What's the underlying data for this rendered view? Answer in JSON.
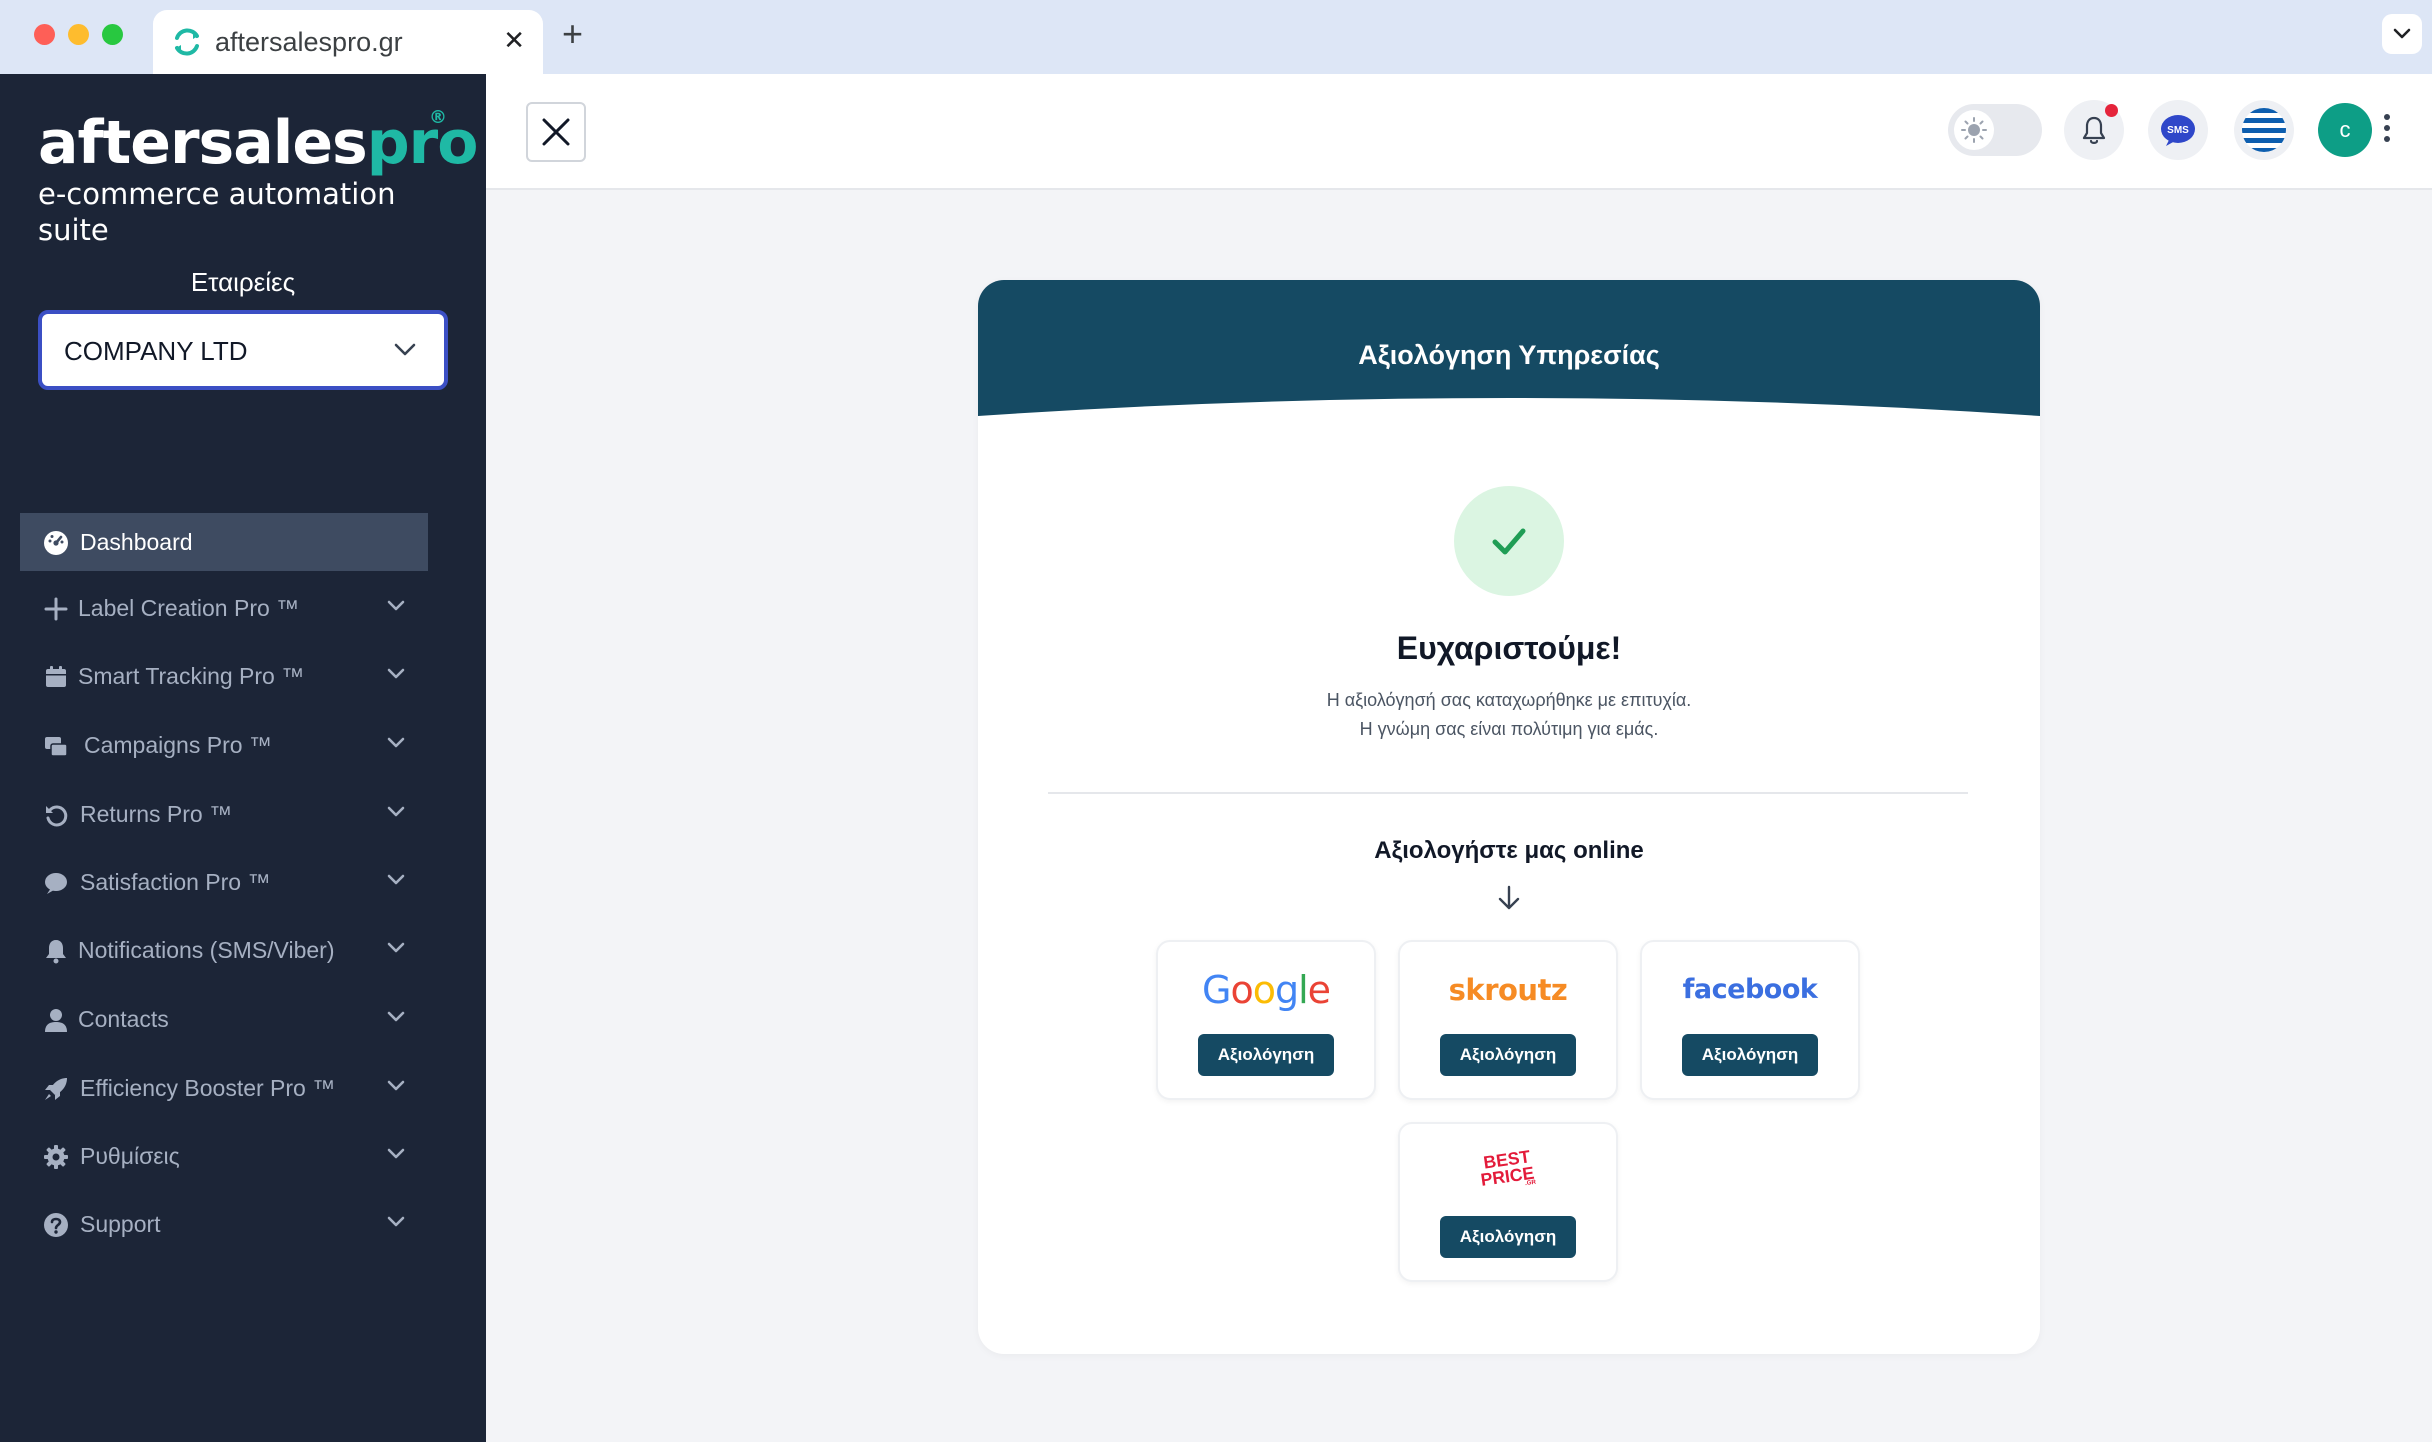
{
  "browser": {
    "tab_title": "aftersalespro.gr",
    "tab_close": "✕",
    "new_tab": "+"
  },
  "sidebar": {
    "logo_main": "aftersales",
    "logo_pro": "pro",
    "logo_reg": "®",
    "logo_subtitle": "e-commerce automation suite",
    "company_label": "Εταιρείες",
    "company_value": "COMPANY LTD",
    "items": [
      {
        "label": "Dashboard",
        "icon": "dashboard-icon"
      },
      {
        "label": "Label Creation Pro ™",
        "icon": "plus-icon"
      },
      {
        "label": "Smart Tracking Pro ™",
        "icon": "calendar-icon"
      },
      {
        "label": "Campaigns Pro ™",
        "icon": "campaigns-icon"
      },
      {
        "label": "Returns Pro ™",
        "icon": "returns-icon"
      },
      {
        "label": "Satisfaction Pro ™",
        "icon": "chat-icon"
      },
      {
        "label": "Notifications (SMS/Viber)",
        "icon": "bell-icon"
      },
      {
        "label": "Contacts",
        "icon": "user-icon"
      },
      {
        "label": "Efficiency Booster Pro ™",
        "icon": "rocket-icon"
      },
      {
        "label": "Ρυθμίσεις",
        "icon": "gear-icon"
      },
      {
        "label": "Support",
        "icon": "question-icon"
      }
    ]
  },
  "topbar": {
    "avatar_initial": "c",
    "sms_label": "SMS"
  },
  "card": {
    "title": "Αξιολόγηση Υπηρεσίας",
    "thanks": "Ευχαριστούμε!",
    "message_line1": "Η αξιολόγησή σας καταχωρήθηκε με επιτυχία.",
    "message_line2": "Η γνώμη σας είναι πολύτιμη για εμάς.",
    "rate_online": "Αξιολογήστε μας online",
    "platforms": [
      {
        "name": "Google",
        "button": "Αξιολόγηση"
      },
      {
        "name": "skroutz",
        "button": "Αξιολόγηση"
      },
      {
        "name": "facebook",
        "button": "Αξιολόγηση"
      },
      {
        "name": "BEST PRICE .GR",
        "button": "Αξιολόγηση"
      }
    ]
  },
  "colors": {
    "sidebar_bg": "#1c2537",
    "brand_teal": "#1fb9a5",
    "card_header": "#154a63",
    "select_border": "#3b4fc4",
    "success_bg": "#dbf5e2",
    "success_check": "#1f9d55"
  }
}
